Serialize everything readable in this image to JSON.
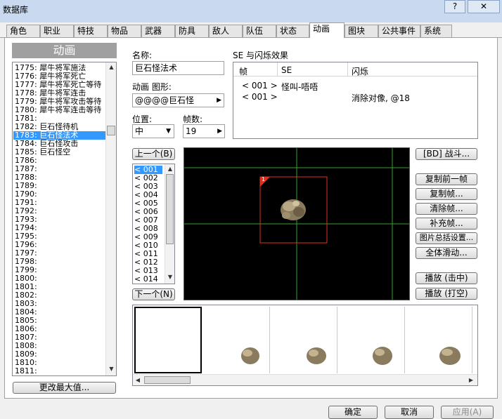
{
  "window": {
    "title": "数据库",
    "help_label": "?",
    "close_label": "✕"
  },
  "tabs": [
    "角色",
    "职业",
    "特技",
    "物品",
    "武器",
    "防具",
    "敌人",
    "队伍",
    "状态",
    "动画",
    "图块",
    "公共事件",
    "系统"
  ],
  "active_tab": 9,
  "left": {
    "header": "动画",
    "items": [
      "1775: 犀牛将军施法",
      "1776: 犀牛将军死亡",
      "1777: 犀牛将军死亡等待",
      "1778: 犀牛将军连击",
      "1779: 犀牛将军攻击等待",
      "1780: 犀牛将军连击等待",
      "1781: ",
      "1782: 巨石怪待机",
      "1783: 巨石怪法术",
      "1784: 巨石怪攻击",
      "1785: 巨石怪空",
      "1786: ",
      "1787: ",
      "1788: ",
      "1789: ",
      "1790: ",
      "1791: ",
      "1792: ",
      "1793: ",
      "1794: ",
      "1795: ",
      "1796: ",
      "1797: ",
      "1798: ",
      "1799: ",
      "1800: ",
      "1801: ",
      "1802: ",
      "1803: ",
      "1804: ",
      "1805: ",
      "1806: ",
      "1807: ",
      "1808: ",
      "1809: ",
      "1810: ",
      "1811: "
    ],
    "selected_index": 8,
    "change_max_label": "更改最大值..."
  },
  "name_label": "名称:",
  "name_value": "巨石怪法术",
  "graphic_label": "动画 图形:",
  "graphic_value": "@@@@巨石怪",
  "position_label": "位置:",
  "position_value": "中",
  "frames_label": "帧数:",
  "frames_value": "19",
  "se": {
    "label": "SE 与闪烁效果",
    "headers": [
      "帧",
      "SE",
      "闪烁"
    ],
    "rows": [
      {
        "frame": "< 001 >",
        "se": "怪叫-唔唔",
        "flash": ""
      },
      {
        "frame": "< 001 >",
        "se": "",
        "flash": "消除对像, @18"
      }
    ]
  },
  "prev_label": "上一个(B)",
  "next_label": "下一个(N)",
  "frame_list": [
    "< 001",
    "< 002",
    "< 003",
    "< 004",
    "< 005",
    "< 006",
    "< 007",
    "< 008",
    "< 009",
    "< 010",
    "< 011",
    "< 012",
    "< 013",
    "< 014"
  ],
  "frame_selected": 0,
  "cell_marker": "1",
  "right_buttons": {
    "battle": "[BD] 战斗...",
    "copy_prev": "复制前一帧",
    "copy_frame": "复制帧...",
    "clear_frame": "清除帧...",
    "fill_frame": "补充帧...",
    "batch": "图片总括设置...",
    "slide": "全体滑动...",
    "play_hit": "播放 (击中)",
    "play_miss": "播放 (打空)"
  },
  "footer": {
    "ok": "确定",
    "cancel": "取消",
    "apply": "应用(A)"
  },
  "colors": {
    "selection": "#3399ff",
    "crosshair": "#2fa52f",
    "cell_border": "#e03020"
  }
}
